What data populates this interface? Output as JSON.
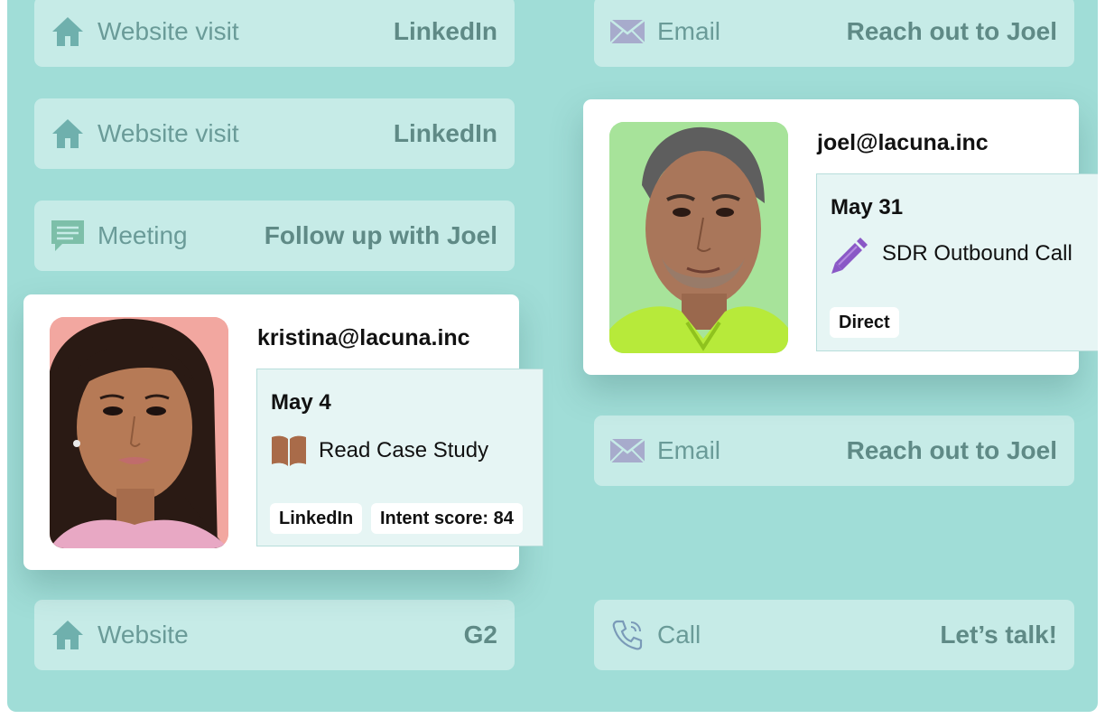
{
  "colors": {
    "panel_bg": "#a0ddd7",
    "row_bg": "#c6ebe7",
    "muted_text": "#6a9b98",
    "house_icon": "#6fb0ad",
    "email_icon": "#a7abcc",
    "meeting_icon": "#7dbfa9",
    "pencil_icon": "#8a58c6",
    "book_icon": "#a96b49"
  },
  "rows": [
    {
      "icon": "house-icon",
      "type": "Website visit",
      "detail": "LinkedIn"
    },
    {
      "icon": "email-icon",
      "type": "Email",
      "detail": "Reach out to Joel"
    },
    {
      "icon": "house-icon",
      "type": "Website visit",
      "detail": "LinkedIn"
    },
    {
      "icon": "speech-bubble-icon",
      "type": "Meeting",
      "detail": "Follow up with Joel"
    },
    {
      "icon": "email-icon",
      "type": "Email",
      "detail": "Reach out to Joel"
    },
    {
      "icon": "house-icon",
      "type": "Website",
      "detail": "G2"
    },
    {
      "icon": "phone-icon",
      "type": "Call",
      "detail": "Let’s talk!"
    }
  ],
  "contacts": {
    "kristina": {
      "email": "kristina@lacuna.inc",
      "date": "May 4",
      "activity_icon": "book-icon",
      "activity": "Read Case Study",
      "tags": [
        "LinkedIn",
        "Intent score: 84"
      ]
    },
    "joel": {
      "email": "joel@lacuna.inc",
      "date": "May 31",
      "activity_icon": "pencil-icon",
      "activity": "SDR Outbound Call",
      "tags": [
        "Direct"
      ]
    }
  }
}
